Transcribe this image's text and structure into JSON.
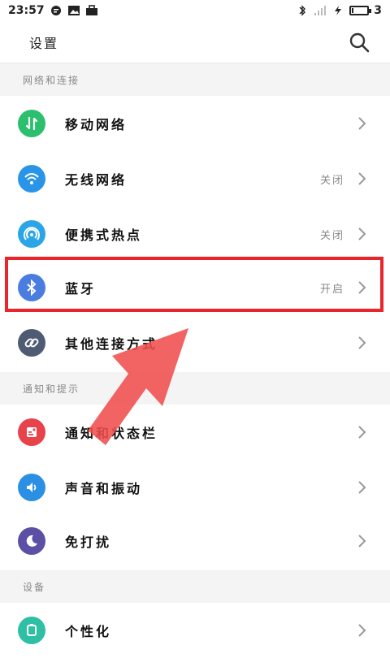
{
  "status_bar": {
    "time": "23:57",
    "battery_level": "3"
  },
  "app_bar": {
    "title": "设置"
  },
  "sections": [
    {
      "header": "网络和连接"
    },
    {
      "header": "通知和提示"
    },
    {
      "header": "设备"
    }
  ],
  "rows": [
    {
      "label": "移动网络",
      "status": "",
      "icon": "mobile-data-icon",
      "color": "#2bbf6e"
    },
    {
      "label": "无线网络",
      "status": "关闭",
      "icon": "wifi-icon",
      "color": "#2a95e8"
    },
    {
      "label": "便携式热点",
      "status": "关闭",
      "icon": "hotspot-icon",
      "color": "#2aa6e8"
    },
    {
      "label": "蓝牙",
      "status": "开启",
      "icon": "bluetooth-icon",
      "color": "#4b7de0"
    },
    {
      "label": "其他连接方式",
      "status": "",
      "icon": "link-icon",
      "color": "#4f5b72"
    },
    {
      "label": "通知和状态栏",
      "status": "",
      "icon": "notification-icon",
      "color": "#e8424a"
    },
    {
      "label": "声音和振动",
      "status": "",
      "icon": "sound-icon",
      "color": "#2b8fe3"
    },
    {
      "label": "免打扰",
      "status": "",
      "icon": "moon-icon",
      "color": "#5b4fa6"
    },
    {
      "label": "个性化",
      "status": "",
      "icon": "personalize-icon",
      "color": "#2ebfa4"
    }
  ]
}
